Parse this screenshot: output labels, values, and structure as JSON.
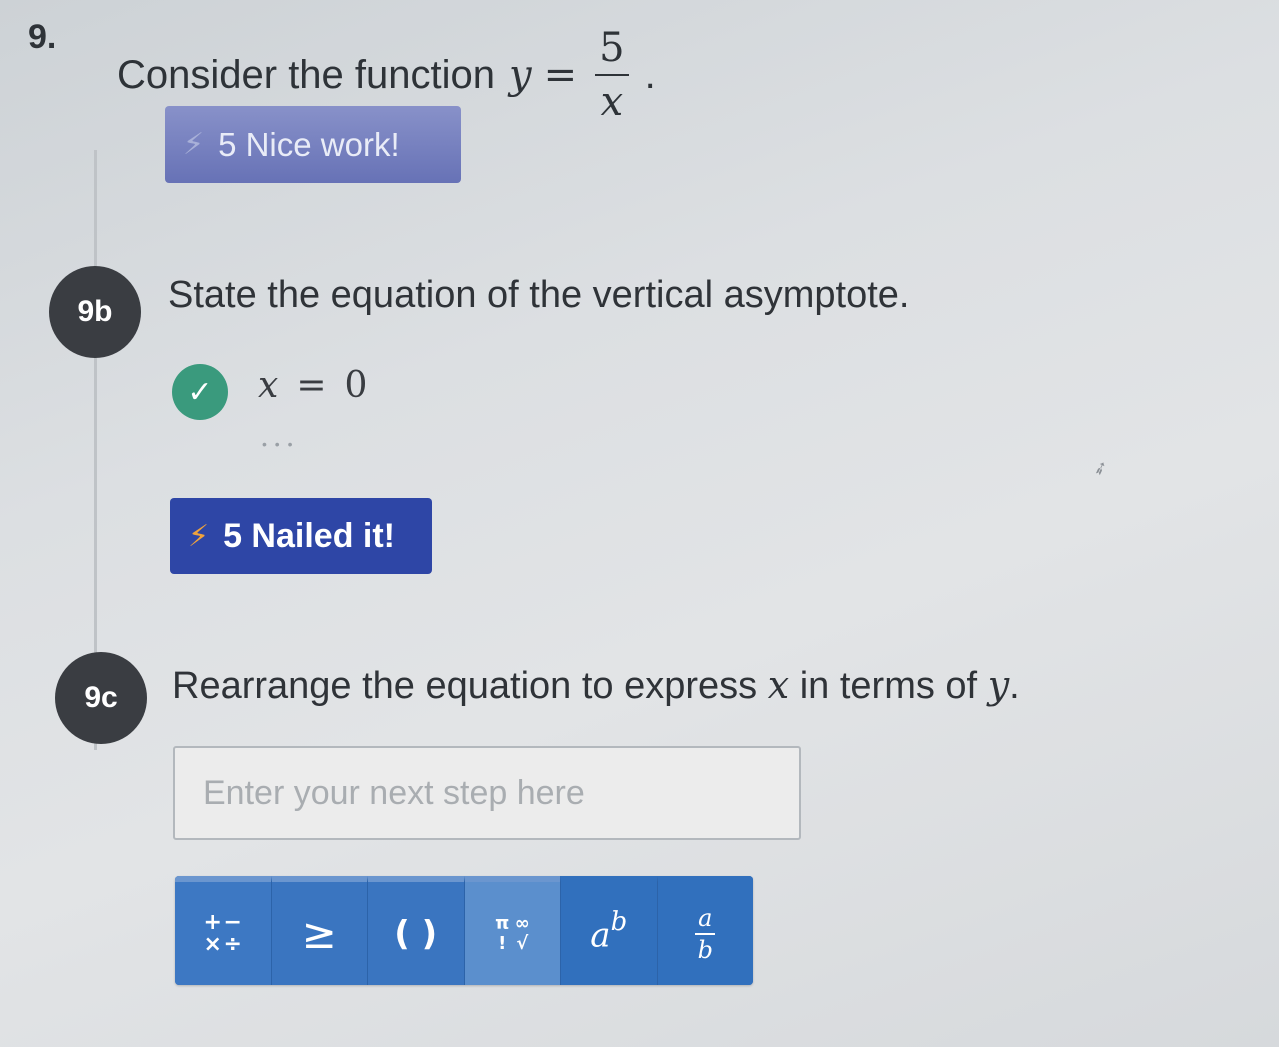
{
  "question": {
    "number": "9.",
    "intro_text": "Consider the function",
    "function": {
      "lhs": "y",
      "equals": "=",
      "numerator": "5",
      "denominator": "x",
      "period": "."
    }
  },
  "badge_first": {
    "icon": "lightning-bolt-icon",
    "text": "5 Nice work!"
  },
  "part_b": {
    "label": "9b",
    "prompt": "State the equation of the vertical asymptote.",
    "answer": {
      "status_icon": "check-icon",
      "lhs": "x",
      "equals": "=",
      "rhs": "0"
    },
    "more": "• • •"
  },
  "badge_second": {
    "icon": "lightning-bolt-icon",
    "text": "5 Nailed it!"
  },
  "part_c": {
    "label": "9c",
    "prompt_pre": "Rearrange the equation to express",
    "var_x": "x",
    "prompt_mid": "in terms of",
    "var_y": "y",
    "prompt_end": ".",
    "input": {
      "value": "",
      "placeholder": "Enter your next step here"
    }
  },
  "toolbar": {
    "ops": [
      "+",
      "−",
      "×",
      "÷"
    ],
    "inequality": "≥",
    "parentheses": "( )",
    "symbols": [
      "π",
      "∞",
      "!",
      "√"
    ],
    "power": {
      "base": "a",
      "exp": "b"
    },
    "fraction": {
      "num": "a",
      "den": "b"
    }
  },
  "colors": {
    "badge_nice": "#6f79bc",
    "badge_nailed": "#2e46a6",
    "bolt": "#f0a33c",
    "check": "#3a9a7d",
    "step_circle": "#3a3d42",
    "toolbar": "#3673bf"
  }
}
